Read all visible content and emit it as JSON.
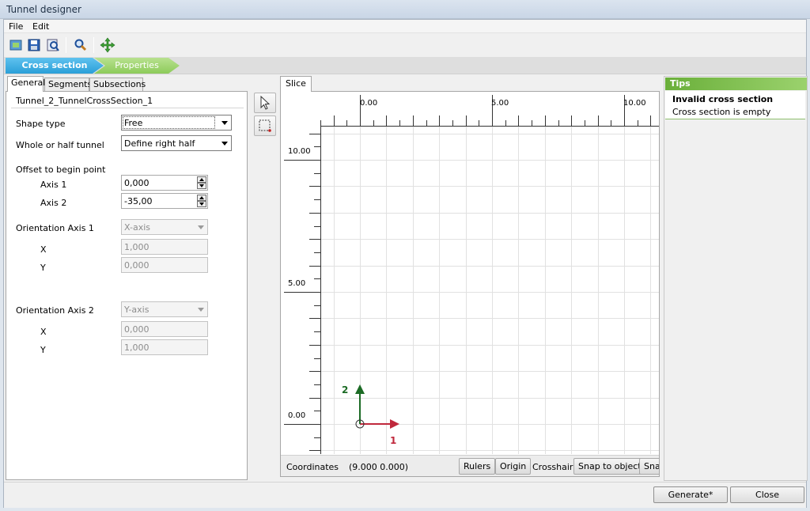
{
  "window": {
    "title": "Tunnel designer"
  },
  "menu": {
    "file": "File",
    "edit": "Edit"
  },
  "wizard": {
    "step1": "Cross section",
    "step2": "Properties"
  },
  "left_tabs": {
    "general": "General",
    "segments": "Segments",
    "subsections": "Subsections"
  },
  "general": {
    "group_title": "Tunnel_2_TunnelCrossSection_1",
    "shape_type_label": "Shape type",
    "shape_type_value": "Free",
    "whole_half_label": "Whole or half tunnel",
    "whole_half_value": "Define right half",
    "offset_label": "Offset to begin point",
    "axis1_label": "Axis 1",
    "axis1_value": "0,000",
    "axis2_label": "Axis 2",
    "axis2_value": "-35,00",
    "orient1_label": "Orientation Axis 1",
    "orient1_value": "X-axis",
    "orient1_x_label": "X",
    "orient1_x_value": "1,000",
    "orient1_y_label": "Y",
    "orient1_y_value": "0,000",
    "orient2_label": "Orientation Axis 2",
    "orient2_value": "Y-axis",
    "orient2_x_label": "X",
    "orient2_x_value": "0,000",
    "orient2_y_label": "Y",
    "orient2_y_value": "1,000"
  },
  "canvas": {
    "tab": "Slice",
    "ruler_top": [
      "0.00",
      "5.00",
      "10.00"
    ],
    "ruler_left": [
      "10.00",
      "5.00",
      "0.00"
    ],
    "axis_x_label": "1",
    "axis_y_label": "2",
    "axis_x_color": "#c0283c",
    "axis_y_color": "#1c6b25"
  },
  "status": {
    "coordinates_label": "Coordinates",
    "coordinates_value": "(9.000 0.000)",
    "rulers": "Rulers",
    "origin": "Origin",
    "crosshair": "Crosshair",
    "snap_object": "Snap to object",
    "snap_grid": "Sna"
  },
  "tips": {
    "header": "Tips",
    "title": "Invalid cross section",
    "text": "Cross section is empty"
  },
  "buttons": {
    "generate": "Generate*",
    "close": "Close"
  }
}
